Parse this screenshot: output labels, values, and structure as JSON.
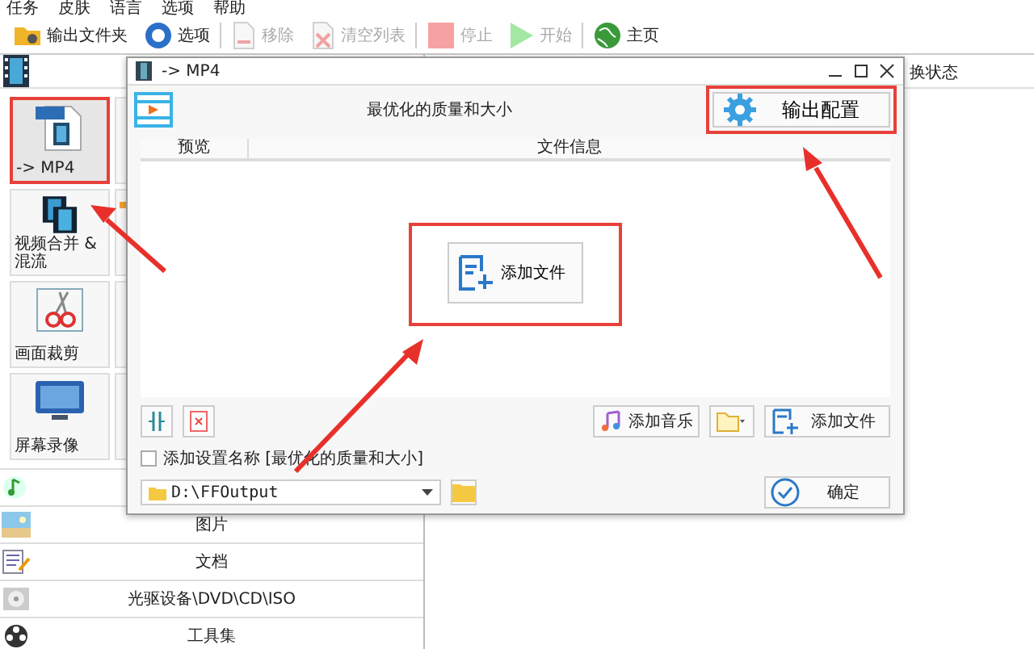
{
  "menu": [
    "任务",
    "皮肤",
    "语言",
    "选项",
    "帮助"
  ],
  "toolbar": [
    {
      "label": "输出文件夹",
      "disabled": false
    },
    {
      "label": "选项",
      "disabled": false
    },
    {
      "label": "移除",
      "disabled": true
    },
    {
      "label": "清空列表",
      "disabled": true
    },
    {
      "label": "停止",
      "disabled": true
    },
    {
      "label": "开始",
      "disabled": true
    },
    {
      "label": "主页",
      "disabled": false
    }
  ],
  "tool_rows": [
    [
      {
        "label": "-> MP4",
        "selected": true
      },
      {
        "selected": false
      }
    ],
    [
      {
        "label": "视频合并 & 混流",
        "selected": false
      },
      {
        "selected": false
      }
    ],
    [
      {
        "label": "画面裁剪",
        "selected": false
      },
      {
        "selected": false
      }
    ],
    [
      {
        "label": "屏幕录像",
        "selected": false
      },
      {
        "selected": false
      }
    ]
  ],
  "categories": [
    {
      "label": "图片"
    },
    {
      "label": "文档"
    },
    {
      "label": "光驱设备\\DVD\\CD\\ISO"
    },
    {
      "label": "工具集"
    }
  ],
  "status_panel": {
    "header": "换状态"
  },
  "dialog": {
    "title": "-> MP4",
    "heading": "最优化的质量和大小",
    "config_button": "输出配置",
    "columns": [
      "预览",
      "文件信息"
    ],
    "center_button": "添加文件",
    "add_music": "添加音乐",
    "add_file": "添加文件",
    "name_option": {
      "label": "添加设置名称 [最优化的质量和大小]",
      "checked": false
    },
    "output_path": "D:\\FFOutput",
    "ok": "确定"
  }
}
